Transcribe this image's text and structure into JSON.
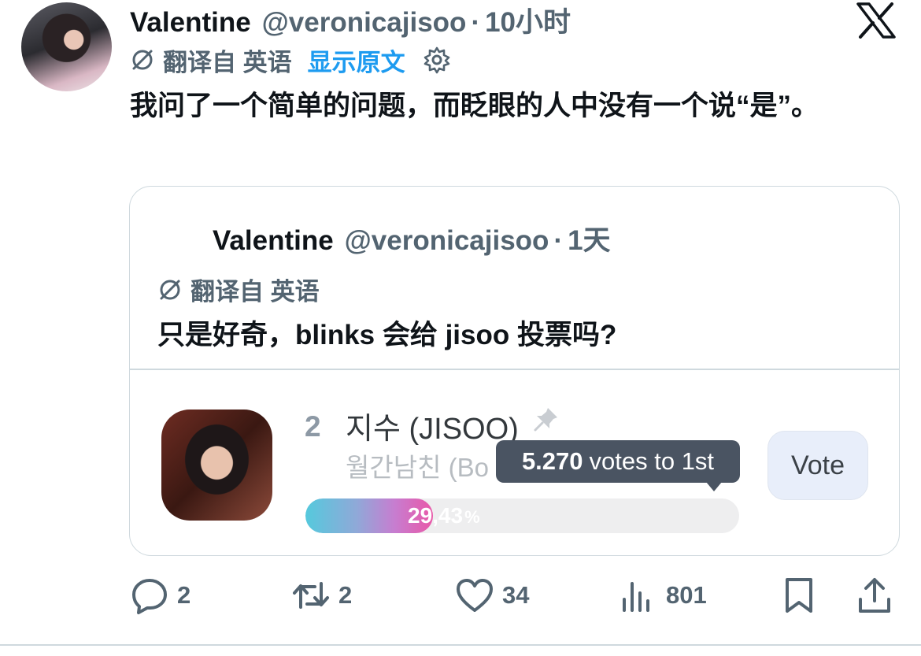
{
  "tweet": {
    "author_name": "Valentine",
    "handle": "@veronicajisoo",
    "separator": "·",
    "time": "10小时",
    "translated_from": "翻译自 英语",
    "show_original": "显示原文",
    "text": "我问了一个简单的问题，而眨眼的人中没有一个说“是”。"
  },
  "quoted_tweet": {
    "author_name": "Valentine",
    "handle": "@veronicajisoo",
    "separator": "·",
    "time": "1天",
    "translated_from": "翻译自 英语",
    "text": "只是好奇，blinks 会给 jisoo 投票吗?"
  },
  "poll": {
    "rank": "2",
    "name": "지수 (JISOO)",
    "subtitle": "월간남친 (Bo",
    "tooltip_bold": "5.270",
    "tooltip_rest": "votes to 1st",
    "vote_label": "Vote",
    "progress_value": "29,43",
    "progress_unit": "%",
    "progress_fraction": 0.2943
  },
  "actions": {
    "replies": "2",
    "retweets": "2",
    "likes": "34",
    "views": "801"
  },
  "icons": {
    "logo": "x-logo-icon",
    "translate": "translate-icon",
    "settings": "gear-icon",
    "pin": "pin-icon",
    "reply": "reply-icon",
    "retweet": "retweet-icon",
    "like": "heart-icon",
    "views": "views-icon",
    "bookmark": "bookmark-icon",
    "share": "share-icon"
  },
  "colors": {
    "text": "#0f1419",
    "secondary": "#536471",
    "link": "#1d9bf0",
    "border": "#cfd9de"
  }
}
